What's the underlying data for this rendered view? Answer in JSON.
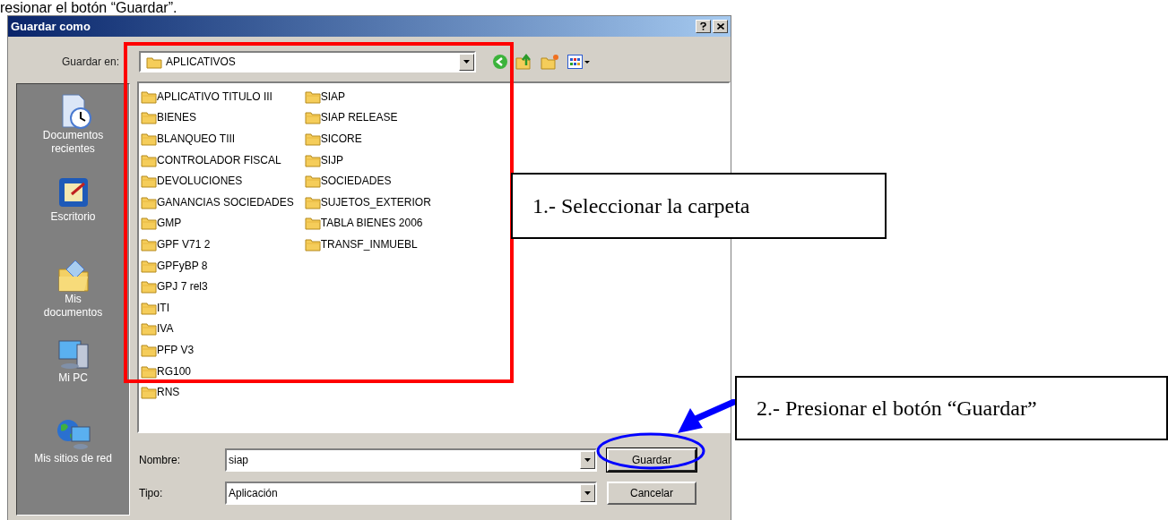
{
  "document_text": "resionar el botón “Guardar”.",
  "dialog": {
    "title": "Guardar como",
    "location": {
      "label": "Guardar en:",
      "value": "APLICATIVOS"
    },
    "places": [
      {
        "kind": "recent",
        "label": "Documentos recientes"
      },
      {
        "kind": "desktop",
        "label": "Escritorio"
      },
      {
        "kind": "documents",
        "label": "Mis documentos"
      },
      {
        "kind": "computer",
        "label": "Mi PC"
      },
      {
        "kind": "network",
        "label": "Mis sitios de red"
      }
    ],
    "folders": [
      "APLICATIVO TITULO III",
      "BIENES",
      "BLANQUEO TIII",
      "CONTROLADOR FISCAL",
      "DEVOLUCIONES",
      "GANANCIAS SOCIEDADES",
      "GMP",
      "GPF V71 2",
      "GPFyBP 8",
      "GPJ 7 rel3",
      "ITI",
      "IVA",
      "PFP V3",
      "RG100",
      "RNS",
      "SIAP",
      "SIAP RELEASE",
      "SICORE",
      "SIJP",
      "SOCIEDADES",
      "SUJETOS_EXTERIOR",
      "TABLA BIENES 2006",
      "TRANSF_INMUEBL"
    ],
    "filename": {
      "label": "Nombre:",
      "value": "siap"
    },
    "filetype": {
      "label": "Tipo:",
      "value": "Aplicación"
    },
    "buttons": [
      "Guardar",
      "Cancelar"
    ]
  },
  "callouts": [
    "1.- Seleccionar la carpeta",
    "2.- Presionar el botón “Guardar”"
  ]
}
